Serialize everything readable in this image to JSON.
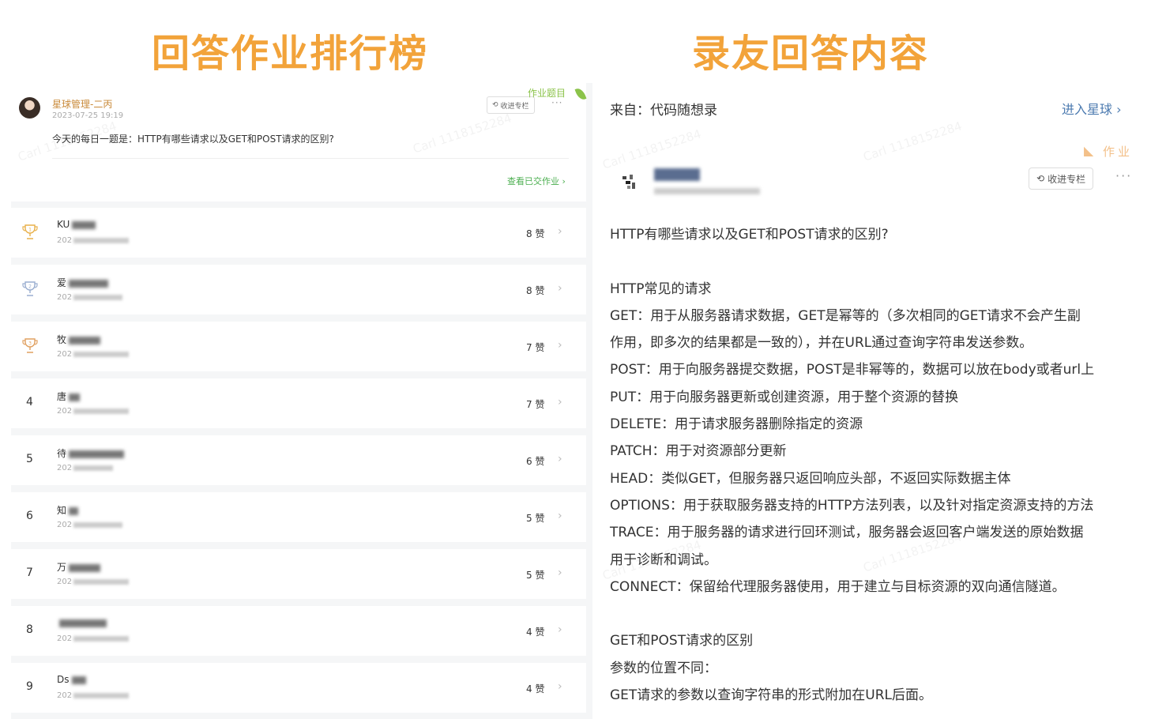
{
  "left_title": "回答作业排行榜",
  "right_title": "录友回答内容",
  "left_post": {
    "author": "星球管理-二丙",
    "time": "2023-07-25 19:19",
    "tag": "作业题目",
    "collect_label": "收进专栏",
    "more": "···",
    "question": "今天的每日一题是：HTTP有哪些请求以及GET和POST请求的区别?",
    "view_submitted": "查看已交作业 ›"
  },
  "ranking": [
    {
      "rank": "1",
      "name": "KU",
      "date": "202",
      "likes": "8 赞",
      "badge": "gold"
    },
    {
      "rank": "2",
      "name": "爱",
      "date": "202",
      "likes": "8 赞",
      "badge": "silver"
    },
    {
      "rank": "3",
      "name": "牧",
      "date": "202",
      "likes": "7 赞",
      "badge": "bronze"
    },
    {
      "rank": "4",
      "name": "唐",
      "date": "202",
      "likes": "7 赞",
      "badge": ""
    },
    {
      "rank": "5",
      "name": "待",
      "date": "202",
      "likes": "6 赞",
      "badge": ""
    },
    {
      "rank": "6",
      "name": "知",
      "date": "202",
      "likes": "5 赞",
      "badge": ""
    },
    {
      "rank": "7",
      "name": "万",
      "date": "202",
      "likes": "5 赞",
      "badge": ""
    },
    {
      "rank": "8",
      "name": "",
      "date": "202",
      "likes": "4 赞",
      "badge": ""
    },
    {
      "rank": "9",
      "name": "Ds",
      "date": "202",
      "likes": "4 赞",
      "badge": ""
    }
  ],
  "right_post": {
    "from": "来自：代码随想录",
    "enter_planet": "进入星球 ›",
    "tag": "作业",
    "collect_label": "收进专栏",
    "more": "···",
    "content_lines": [
      "HTTP有哪些请求以及GET和POST请求的区别?",
      "",
      "HTTP常见的请求",
      "GET：用于从服务器请求数据，GET是幂等的（多次相同的GET请求不会产生副",
      "作用，即多次的结果都是一致的），并在URL通过查询字符串发送参数。",
      "POST：用于向服务器提交数据，POST是非幂等的，数据可以放在body或者url上",
      "PUT：用于向服务器更新或创建资源，用于整个资源的替换",
      "DELETE：用于请求服务器删除指定的资源",
      "PATCH：用于对资源部分更新",
      "HEAD：类似GET，但服务器只返回响应头部，不返回实际数据主体",
      "OPTIONS：用于获取服务器支持的HTTP方法列表，以及针对指定资源支持的方法",
      "TRACE：用于服务器的请求进行回环测试，服务器会返回客户端发送的原始数据",
      "用于诊断和调试。",
      "CONNECT：保留给代理服务器使用，用于建立与目标资源的双向通信隧道。",
      "",
      "GET和POST请求的区别",
      "参数的位置不同：",
      "GET请求的参数以查询字符串的形式附加在URL后面。"
    ]
  },
  "colors": {
    "title_orange": "#f2a33a",
    "link_blue": "#4d7bb0",
    "green": "#4caf50",
    "gold": "#e8b04a",
    "silver": "#9aaed0",
    "bronze": "#e0a060"
  }
}
